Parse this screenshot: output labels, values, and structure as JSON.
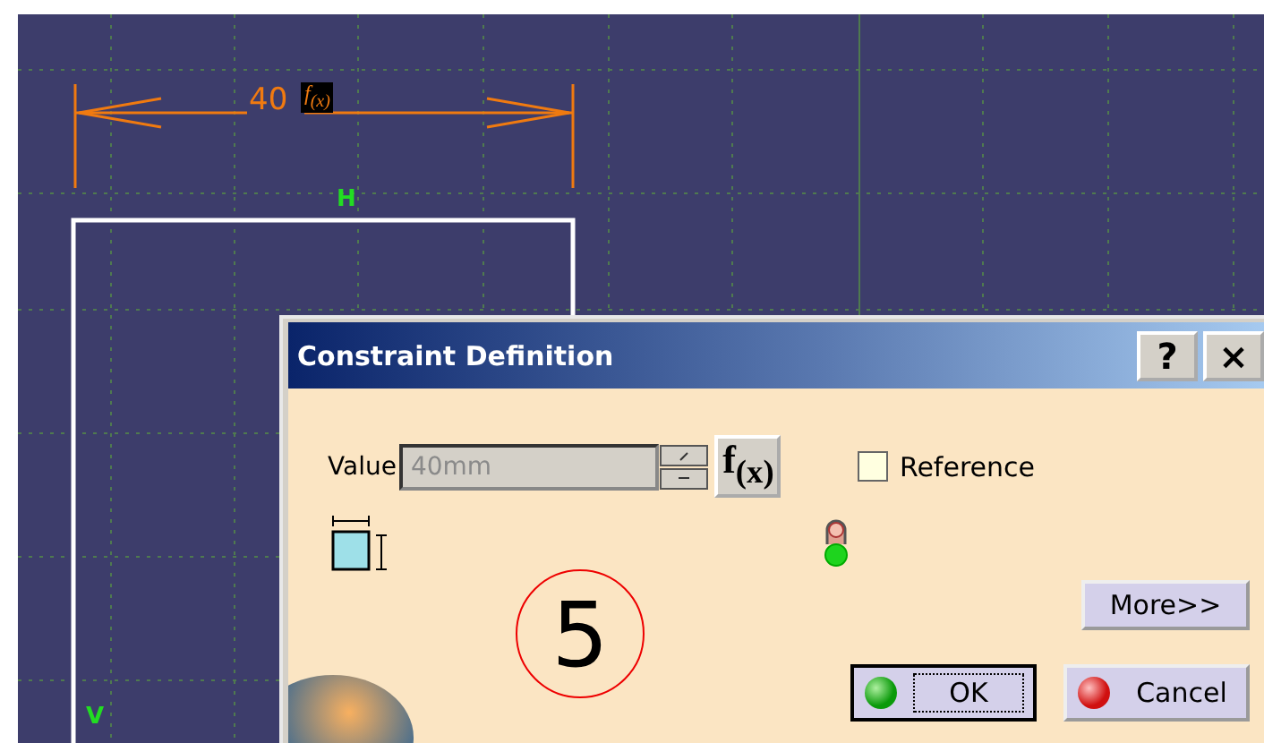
{
  "sketch": {
    "dimension": {
      "value": "40",
      "formula_badge": "f$_{(x)}$"
    },
    "horizontal_constraint": "H",
    "vertical_constraint": "V"
  },
  "dialog": {
    "title": "Constraint Definition",
    "help_button": "?",
    "close_button": "×",
    "value_label": "Value",
    "value_field": {
      "value": "40mm",
      "disabled": true
    },
    "formula_button": "f$_{(x)}$",
    "reference": {
      "label": "Reference",
      "checked": false
    },
    "callout": "5",
    "buttons": [
      {
        "label": "More>>",
        "kind": "more"
      },
      {
        "label": "OK",
        "kind": "ok",
        "focused": true
      },
      {
        "label": "Cancel",
        "kind": "cancel",
        "focused": false
      }
    ]
  }
}
